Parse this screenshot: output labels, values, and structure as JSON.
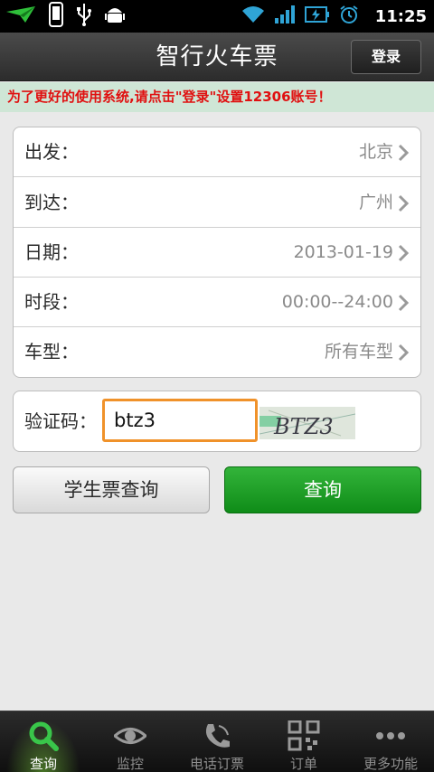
{
  "status_bar": {
    "time": "11:25"
  },
  "header": {
    "title": "智行火车票",
    "login_label": "登录"
  },
  "notice": "为了更好的使用系统,请点击\"登录\"设置12306账号！",
  "form": {
    "rows": [
      {
        "label": "出发：",
        "value": "北京"
      },
      {
        "label": "到达：",
        "value": "广州"
      },
      {
        "label": "日期：",
        "value": "2013-01-19"
      },
      {
        "label": "时段：",
        "value": "00:00--24:00"
      },
      {
        "label": "车型：",
        "value": "所有车型"
      }
    ]
  },
  "captcha": {
    "label": "验证码：",
    "input_value": "btz3",
    "image_text": "BTZ3"
  },
  "buttons": {
    "student_label": "学生票查询",
    "query_label": "查询"
  },
  "tabs": [
    {
      "label": "查询",
      "icon": "search-icon",
      "active": true
    },
    {
      "label": "监控",
      "icon": "eye-icon",
      "active": false
    },
    {
      "label": "电话订票",
      "icon": "phone-icon",
      "active": false
    },
    {
      "label": "订单",
      "icon": "qr-code-icon",
      "active": false
    },
    {
      "label": "更多功能",
      "icon": "more-icon",
      "active": false
    }
  ],
  "colors": {
    "accent_green": "#1a9e24",
    "notice_red": "#e01010",
    "input_focus": "#f0922a"
  }
}
